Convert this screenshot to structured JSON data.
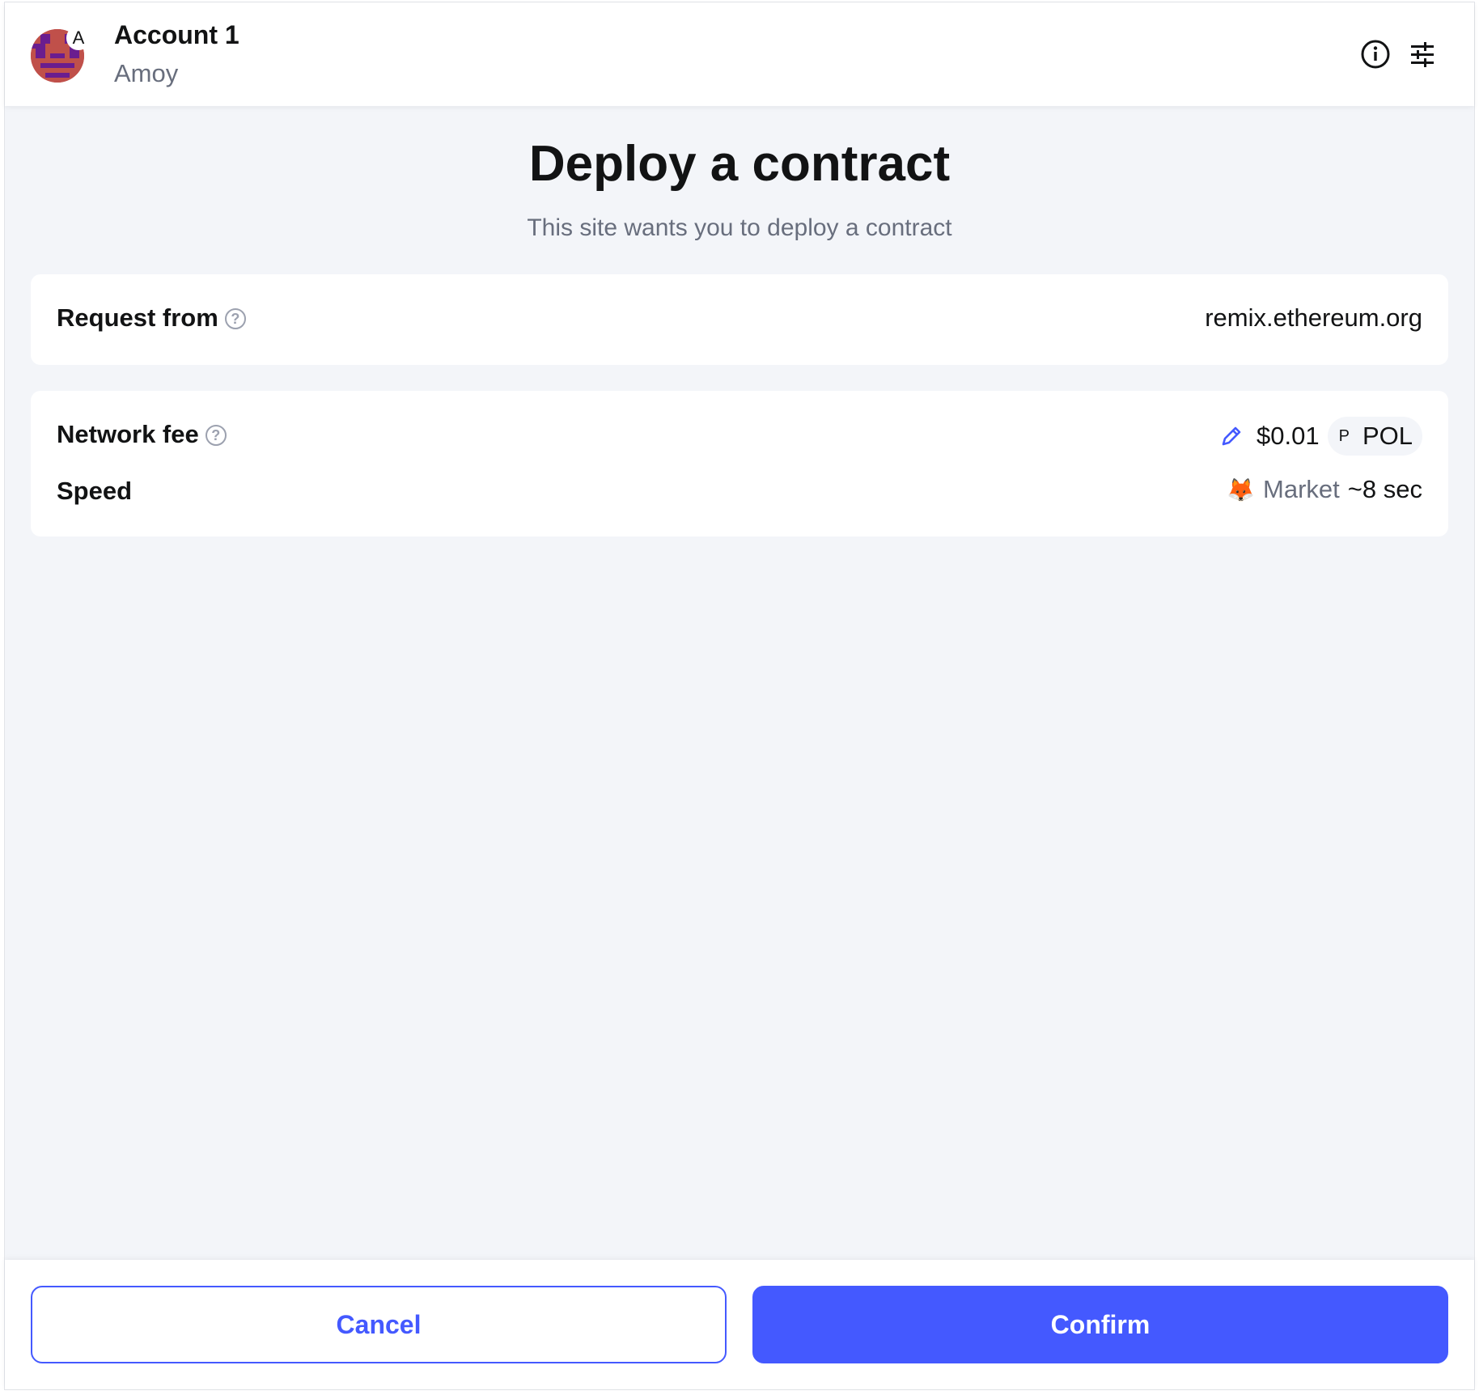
{
  "header": {
    "account_name": "Account 1",
    "network_name": "Amoy",
    "network_badge_letter": "A",
    "info_icon": "info-icon",
    "settings_icon": "sliders-icon"
  },
  "main": {
    "title": "Deploy a contract",
    "subtitle": "This site wants you to deploy a contract"
  },
  "request": {
    "label": "Request from",
    "value": "remix.ethereum.org"
  },
  "fee": {
    "label": "Network fee",
    "amount": "$0.01",
    "token_letter": "P",
    "token_name": "POL",
    "speed_label": "Speed",
    "speed_emoji": "🦊",
    "speed_mode": "Market",
    "speed_time": "~8 sec"
  },
  "footer": {
    "cancel_label": "Cancel",
    "confirm_label": "Confirm"
  },
  "colors": {
    "accent": "#4459ff",
    "background": "#f3f5f9",
    "muted_text": "#686e7d"
  }
}
